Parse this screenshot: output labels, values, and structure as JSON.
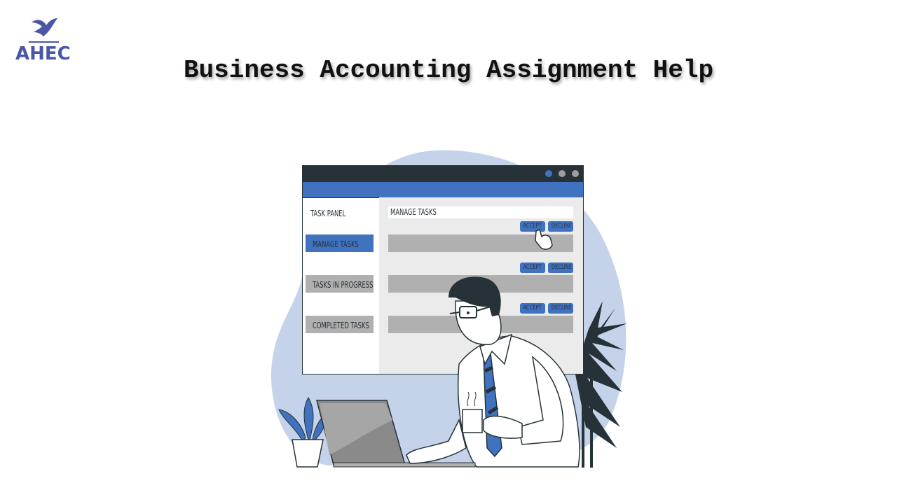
{
  "logo": {
    "text": "AHEC",
    "color": "#4a57a8"
  },
  "title": "Business Accounting Assignment Help",
  "illustration": {
    "window": {
      "sidebar_title": "TASK PANEL",
      "sidebar_items": [
        {
          "label": "MANAGE TASKS",
          "active": true
        },
        {
          "label": "TASKS IN PROGRESS",
          "active": false
        },
        {
          "label": "COMPLETED TASKS",
          "active": false
        }
      ],
      "main_header": "MANAGE TASKS",
      "task_rows": [
        {
          "accept": "ACCEPT",
          "decline": "DECLINE"
        },
        {
          "accept": "ACCEPT",
          "decline": "DECLINE"
        },
        {
          "accept": "ACCEPT",
          "decline": "DECLINE"
        }
      ]
    },
    "colors": {
      "blob": "#c5d3ea",
      "dark": "#263238",
      "accent": "#4072c0",
      "gray": "#b0b0b0"
    }
  }
}
